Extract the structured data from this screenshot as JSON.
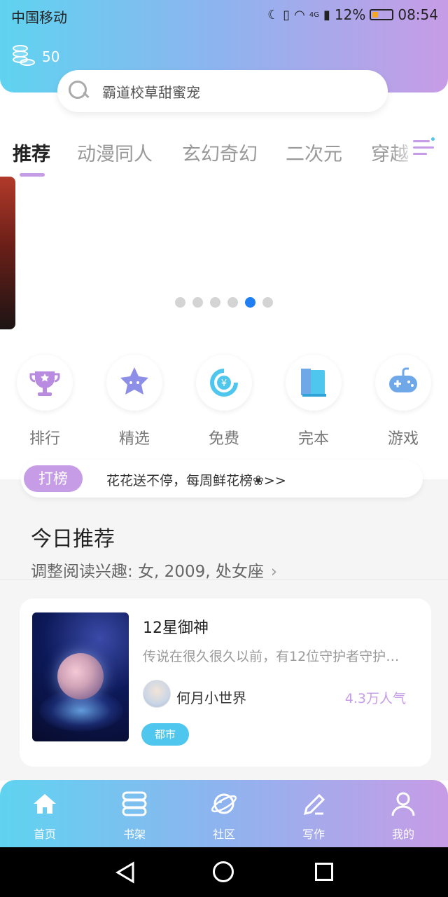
{
  "status_bar": {
    "carrier": "中国移动",
    "network": "4G",
    "battery": "12%",
    "time": "08:54"
  },
  "header": {
    "coin_count": "50",
    "search_placeholder": "霸道校草甜蜜宠"
  },
  "tabs": [
    "推荐",
    "动漫同人",
    "玄幻奇幻",
    "二次元",
    "穿越"
  ],
  "banner": {
    "total_slides": 6,
    "active_index": 4
  },
  "quick_links": [
    {
      "label": "排行",
      "icon": "trophy-icon"
    },
    {
      "label": "精选",
      "icon": "star-icon"
    },
    {
      "label": "免费",
      "icon": "yuan-refresh-icon"
    },
    {
      "label": "完本",
      "icon": "book-icon"
    },
    {
      "label": "游戏",
      "icon": "gamepad-icon"
    }
  ],
  "notice": {
    "badge": "打榜",
    "text": "花花送不停，每周鲜花榜❀>>"
  },
  "recommend": {
    "title": "今日推荐",
    "subtitle": "调整阅读兴趣: 女, 2009, 处女座"
  },
  "book": {
    "title": "12星御神",
    "description": "传说在很久很久以前，有12位守护者守护着...",
    "author": "何月小世界",
    "popularity": "4.3万人气",
    "genre": "都市"
  },
  "bottom_nav": [
    {
      "label": "首页",
      "icon": "home-icon"
    },
    {
      "label": "书架",
      "icon": "bookshelf-icon"
    },
    {
      "label": "社区",
      "icon": "planet-icon"
    },
    {
      "label": "写作",
      "icon": "pen-icon"
    },
    {
      "label": "我的",
      "icon": "user-icon"
    }
  ],
  "colors": {
    "gradient_start": "#5fd3f0",
    "gradient_end": "#c79ce6",
    "accent_purple": "#c79ce6",
    "active_dot": "#1e7ef2",
    "tag_blue": "#4fc6ee"
  }
}
